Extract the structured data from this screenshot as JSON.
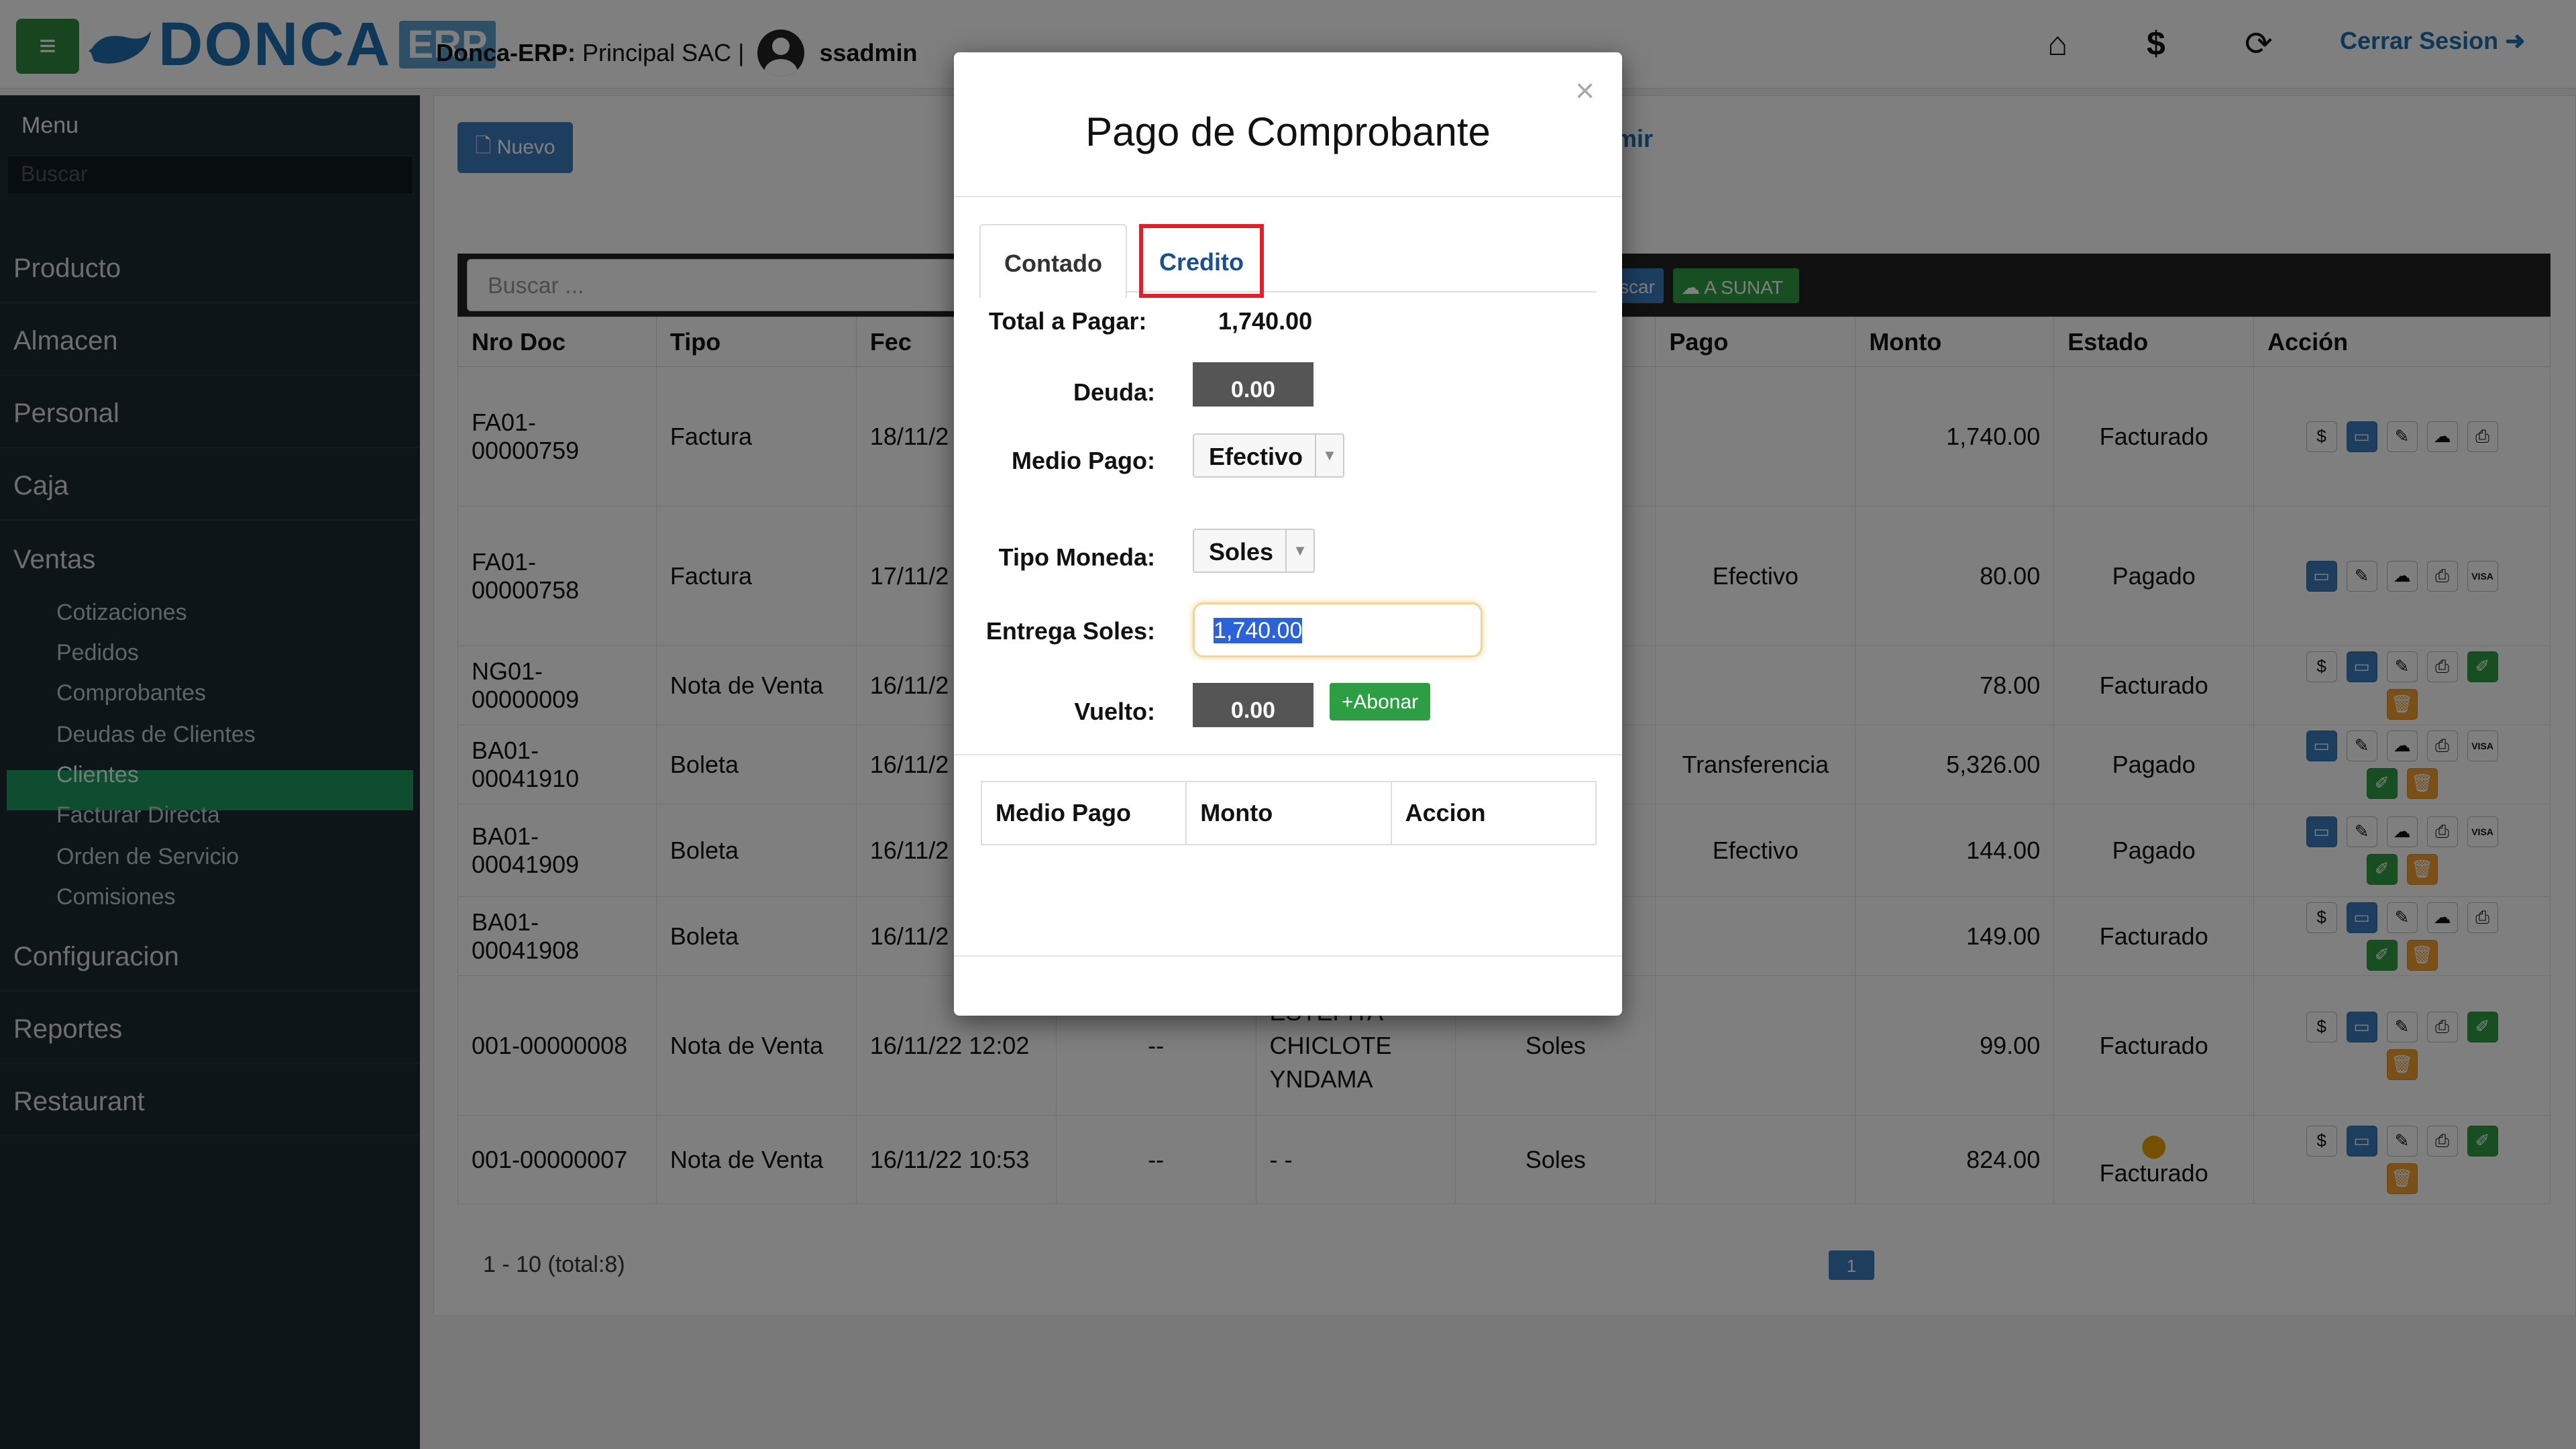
{
  "header": {
    "logo_word": "DONCA",
    "logo_suffix": "ERP",
    "company_label": "Donca-ERP:",
    "company_name": "Principal SAC |",
    "user": "ssadmin",
    "logout": "Cerrar Sesion"
  },
  "sidebar": {
    "title": "Menu",
    "search_placeholder": "Buscar",
    "items": [
      "Producto",
      "Almacen",
      "Personal",
      "Caja",
      "Ventas",
      "Configuracion",
      "Reportes",
      "Restaurant"
    ],
    "sub_items": [
      "Cotizaciones",
      "Pedidos",
      "Comprobantes",
      "Deudas de Clientes",
      "Clientes",
      "Facturar Directa",
      "Orden de Servicio",
      "Comisiones"
    ],
    "active_sub": "Comprobantes"
  },
  "main": {
    "nuevo_label": "Nuevo",
    "imprimir_fragment": "mir",
    "search_placeholder": "Buscar ...",
    "buscar_fragment": "scar",
    "sunat_label": "A SUNAT",
    "pagination_text": "1 - 10 (total:8)",
    "page": "1"
  },
  "table": {
    "headers": [
      "Nro Doc",
      "Tipo",
      "Fec",
      "",
      "",
      "",
      "Pago",
      "Monto",
      "Estado",
      "Acción"
    ],
    "rows": [
      {
        "doc": "FA01-00000759",
        "tipo": "Factura",
        "fecha": "18/11/2",
        "c4": "",
        "cliente": "",
        "moneda": "",
        "pago": "",
        "monto": "1,740.00",
        "estado": "Facturado"
      },
      {
        "doc": "FA01-00000758",
        "tipo": "Factura",
        "fecha": "17/11/2",
        "c4": "",
        "cliente": "",
        "moneda": "",
        "pago": "Efectivo",
        "monto": "80.00",
        "estado": "Pagado"
      },
      {
        "doc": "NG01-00000009",
        "tipo": "Nota de Venta",
        "fecha": "16/11/2",
        "c4": "",
        "cliente": "",
        "moneda": "",
        "pago": "",
        "monto": "78.00",
        "estado": "Facturado"
      },
      {
        "doc": "BA01-00041910",
        "tipo": "Boleta",
        "fecha": "16/11/2",
        "c4": "",
        "cliente": "",
        "moneda": "",
        "pago": "Transferencia",
        "monto": "5,326.00",
        "estado": "Pagado"
      },
      {
        "doc": "BA01-00041909",
        "tipo": "Boleta",
        "fecha": "16/11/2",
        "c4": "",
        "cliente": "",
        "moneda": "",
        "pago": "Efectivo",
        "monto": "144.00",
        "estado": "Pagado"
      },
      {
        "doc": "BA01-00041908",
        "tipo": "Boleta",
        "fecha": "16/11/2",
        "c4": "",
        "cliente": "",
        "moneda": "",
        "pago": "",
        "monto": "149.00",
        "estado": "Facturado"
      },
      {
        "doc": "001-00000008",
        "tipo": "Nota de Venta",
        "fecha": "16/11/22 12:02",
        "c4": "--",
        "cliente": "ESTEFITA CHICLOTE YNDAMA",
        "moneda": "Soles",
        "pago": "",
        "monto": "99.00",
        "estado": "Facturado"
      },
      {
        "doc": "001-00000007",
        "tipo": "Nota de Venta",
        "fecha": "16/11/22 10:53",
        "c4": "--",
        "cliente": "- -",
        "moneda": "Soles",
        "pago": "",
        "monto": "824.00",
        "estado": "Facturado"
      }
    ]
  },
  "modal": {
    "close": "×",
    "title": "Pago de Comprobante",
    "tabs": [
      "Contado",
      "Credito"
    ],
    "total_label": "Total a Pagar:",
    "total_value": "1,740.00",
    "deuda_label": "Deuda:",
    "deuda_value": "0.00",
    "medio_label": "Medio Pago:",
    "medio_value": "Efectivo",
    "moneda_label": "Tipo Moneda:",
    "moneda_value": "Soles",
    "entrega_label": "Entrega Soles:",
    "entrega_value": "1,740.00",
    "vuelto_label": "Vuelto:",
    "vuelto_value": "0.00",
    "abonar_label": "+Abonar",
    "pay_headers": [
      "Medio Pago",
      "Monto",
      "Accion"
    ]
  }
}
